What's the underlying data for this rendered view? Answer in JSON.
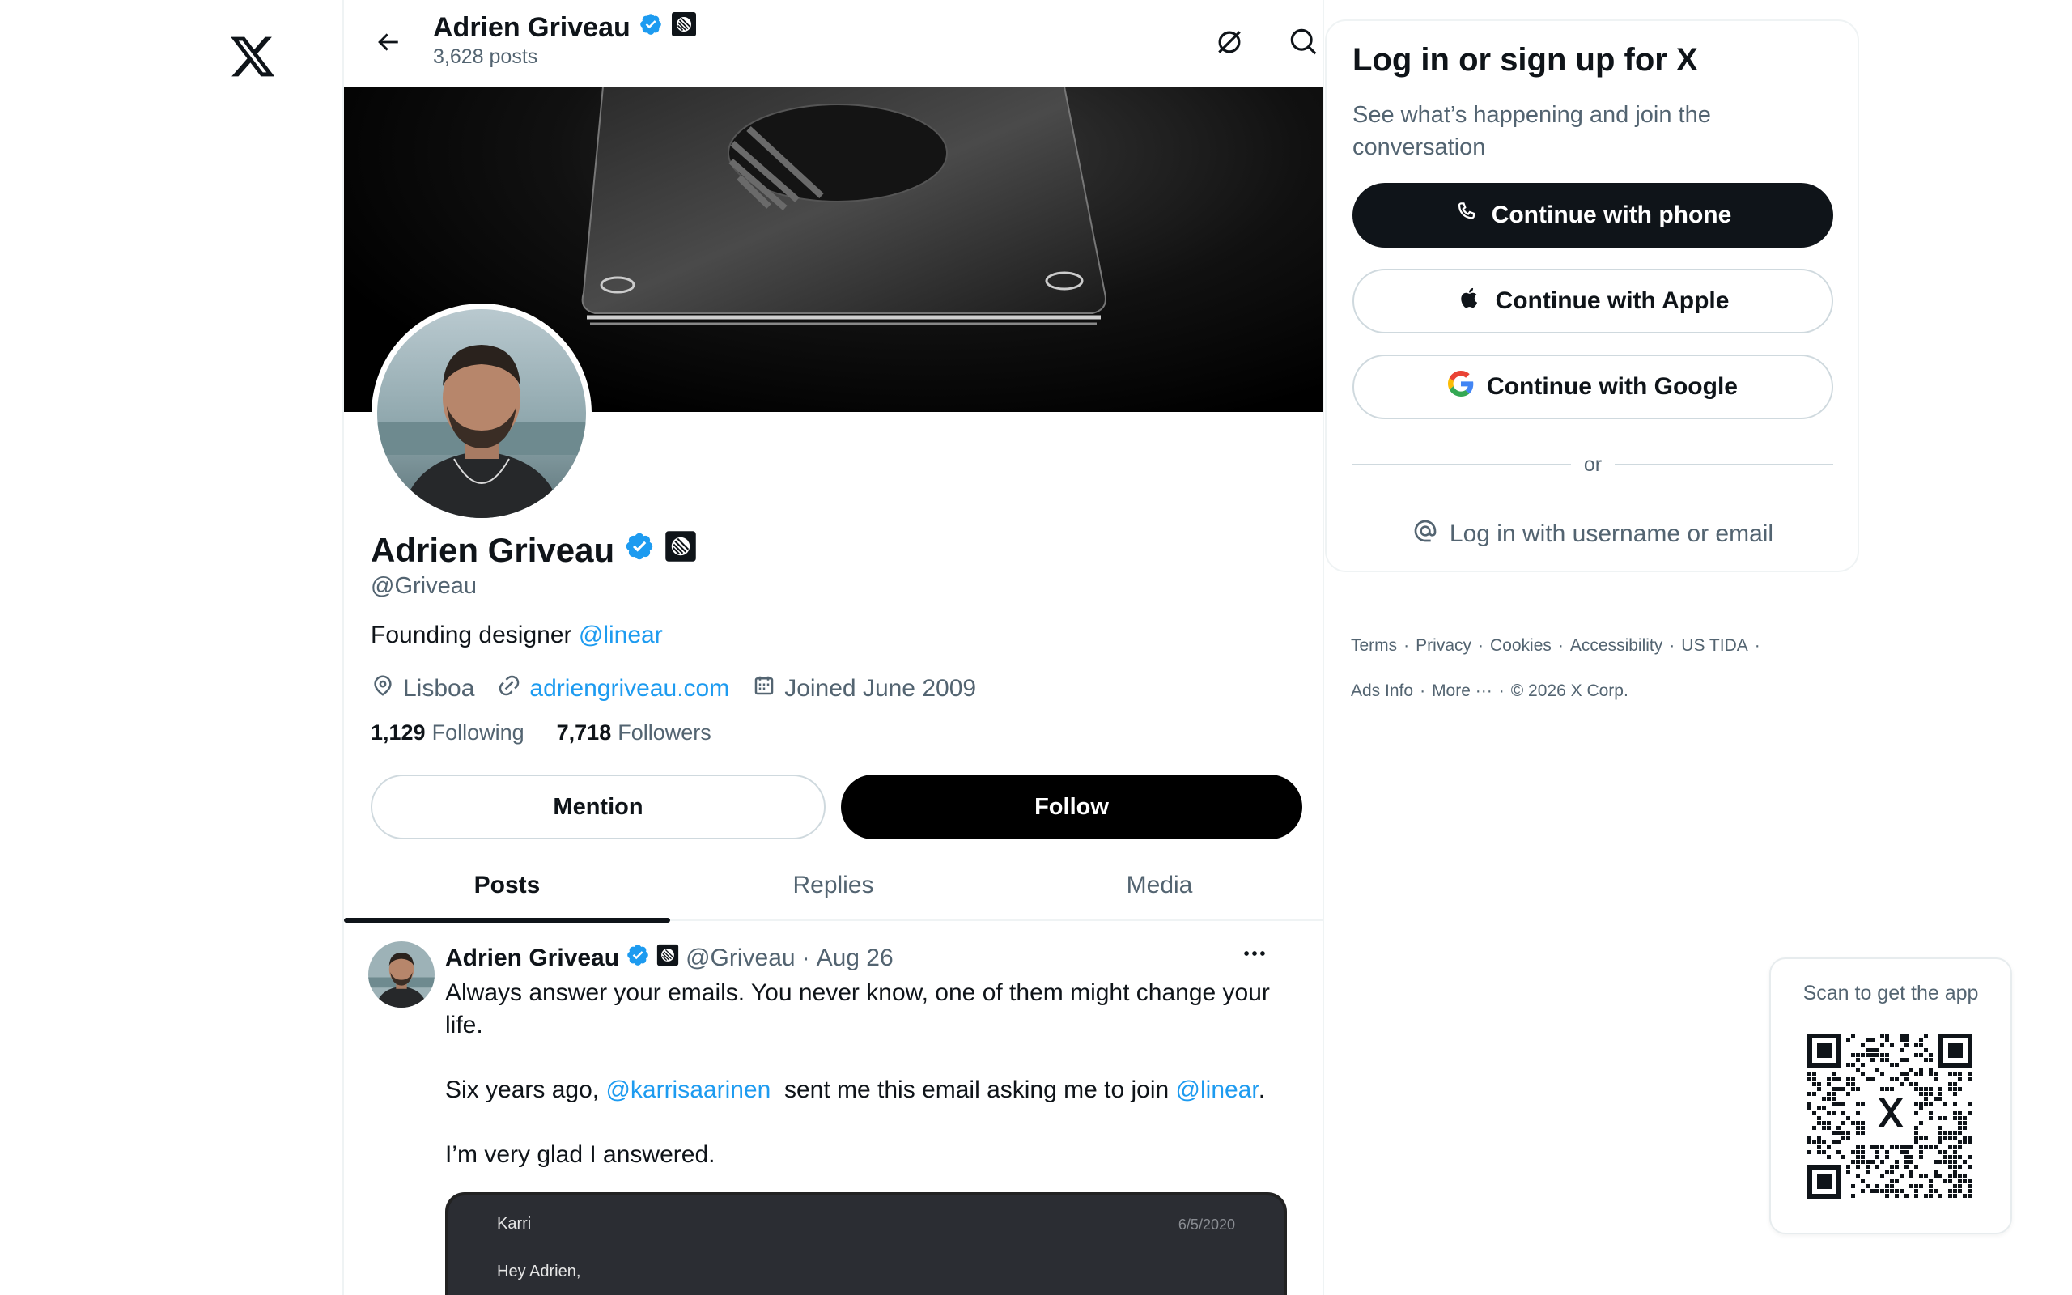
{
  "profile": {
    "name": "Adrien Griveau",
    "posts_count": "3,628 posts",
    "handle": "@Griveau",
    "bio_prefix": "Founding designer ",
    "bio_link": "@linear",
    "location": "Lisboa",
    "website": "adriengriveau.com",
    "joined": "Joined June 2009",
    "following_count": "1,129",
    "following_label": "Following",
    "followers_count": "7,718",
    "followers_label": "Followers"
  },
  "actions": {
    "mention_label": "Mention",
    "follow_label": "Follow"
  },
  "tabs": [
    {
      "label": "Posts"
    },
    {
      "label": "Replies"
    },
    {
      "label": "Media"
    }
  ],
  "post": {
    "name": "Adrien Griveau",
    "handle": "@Griveau",
    "sep": "·",
    "date": "Aug 26",
    "line1": "Always answer your emails. You never know, one of them might change your life.",
    "line2_prefix": "Six years ago, ",
    "line2_mention1": "@karrisaarinen",
    "line2_middle": "  sent me this email asking me to join ",
    "line2_mention2": "@linear",
    "line2_suffix": ".",
    "line3": "I’m very glad I answered.",
    "email": {
      "from": "Karri",
      "date": "6/5/2020",
      "greeting": "Hey Adrien,"
    }
  },
  "login": {
    "title": "Log in or sign up for X",
    "subtitle": "See what’s happening and join the conversation",
    "phone_label": "Continue with phone",
    "apple_label": "Continue with Apple",
    "google_label": "Continue with Google",
    "or_label": "or",
    "username_label": "Log in with username or email"
  },
  "footer": {
    "terms": "Terms",
    "privacy": "Privacy",
    "cookies": "Cookies",
    "accessibility": "Accessibility",
    "us_tida": "US TIDA",
    "ads_info": "Ads Info",
    "more": "More",
    "copyright": "© 2026 X Corp.",
    "dot": "·"
  },
  "qr": {
    "label": "Scan to get the app"
  },
  "colors": {
    "accent": "#1d9bf0",
    "text": "#0f1419",
    "muted": "#536471",
    "border": "#eff3f4"
  }
}
